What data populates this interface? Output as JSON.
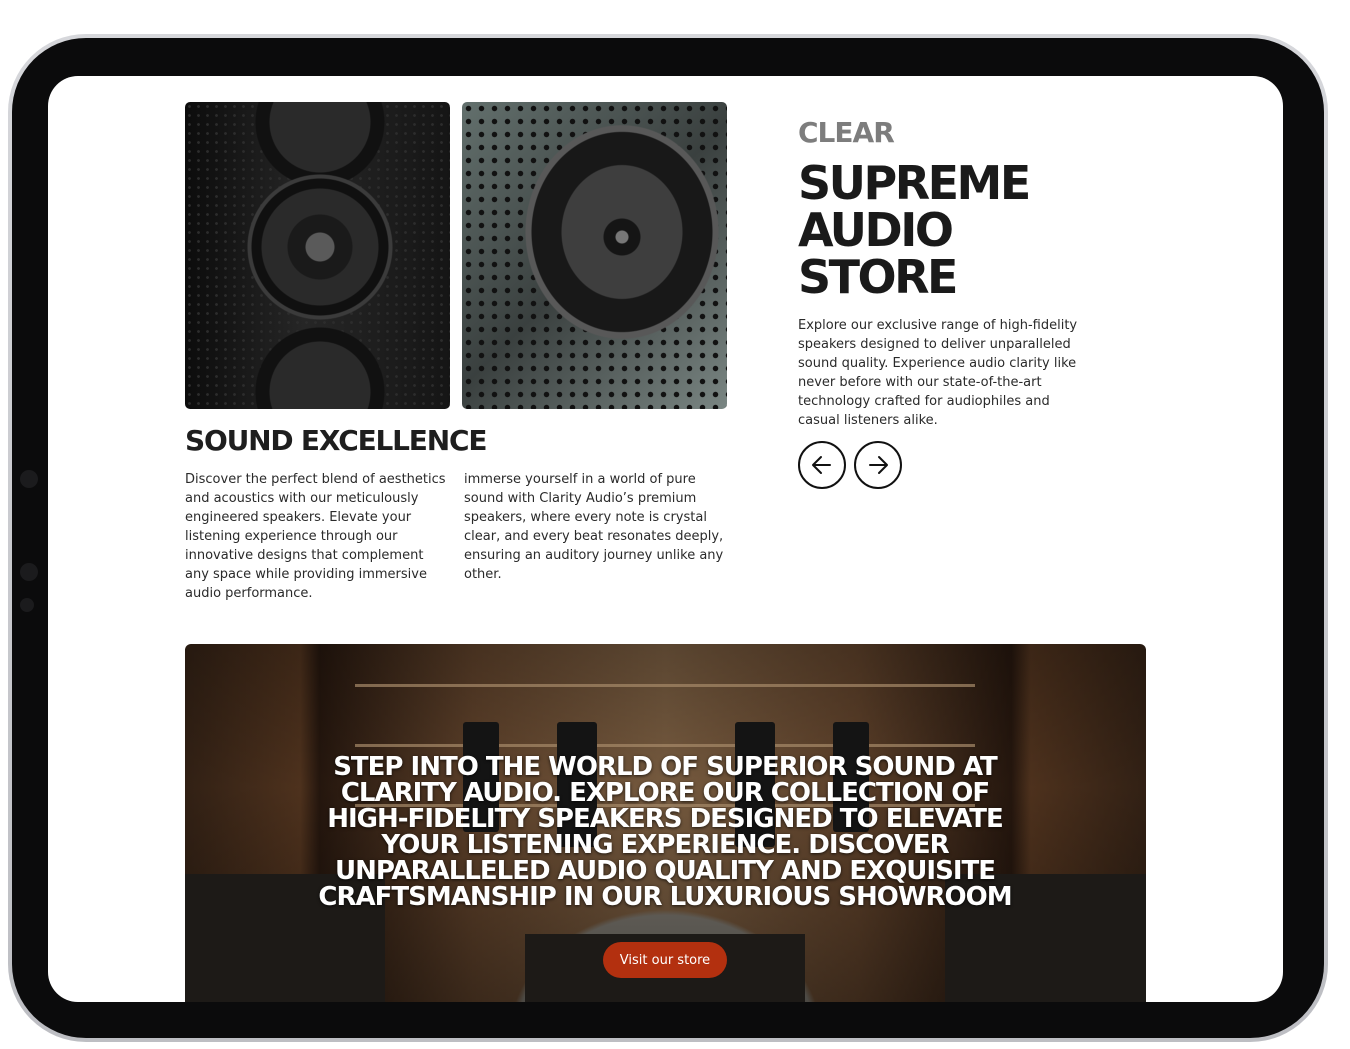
{
  "gallery": {
    "image1": "tower-speaker-photo",
    "image2": "speaker-grille-closeup-photo"
  },
  "excellence": {
    "title": "SOUND EXCELLENCE",
    "paragraph1": "Discover the perfect blend of aesthetics and acoustics with our meticulously engineered speakers. Elevate your listening experience through our innovative designs that complement any space while providing immersive audio performance.",
    "paragraph2": "immerse yourself in a world of pure sound with Clarity Audio’s premium speakers, where every note is crystal clear, and every beat resonates deeply, ensuring an auditory journey unlike any other."
  },
  "hero": {
    "kicker": "CLEAR",
    "title": "SUPREME AUDIO STORE",
    "description": "Explore our exclusive range of high-fidelity speakers designed to deliver unparalleled sound quality. Experience audio clarity like never before with our state-of-the-art technology crafted for audiophiles and casual listeners alike.",
    "prev_icon": "arrow-left-icon",
    "next_icon": "arrow-right-icon"
  },
  "banner": {
    "text": "STEP INTO THE WORLD OF SUPERIOR SOUND AT CLARITY AUDIO. EXPLORE OUR COLLECTION OF HIGH-FIDELITY SPEAKERS DESIGNED TO ELEVATE YOUR LISTENING EXPERIENCE. DISCOVER UNPARALLELED AUDIO QUALITY AND EXQUISITE CRAFTSMANSHIP IN OUR LUXURIOUS SHOWROOM",
    "button_label": "Visit our store",
    "button_color": "#b3300f"
  }
}
